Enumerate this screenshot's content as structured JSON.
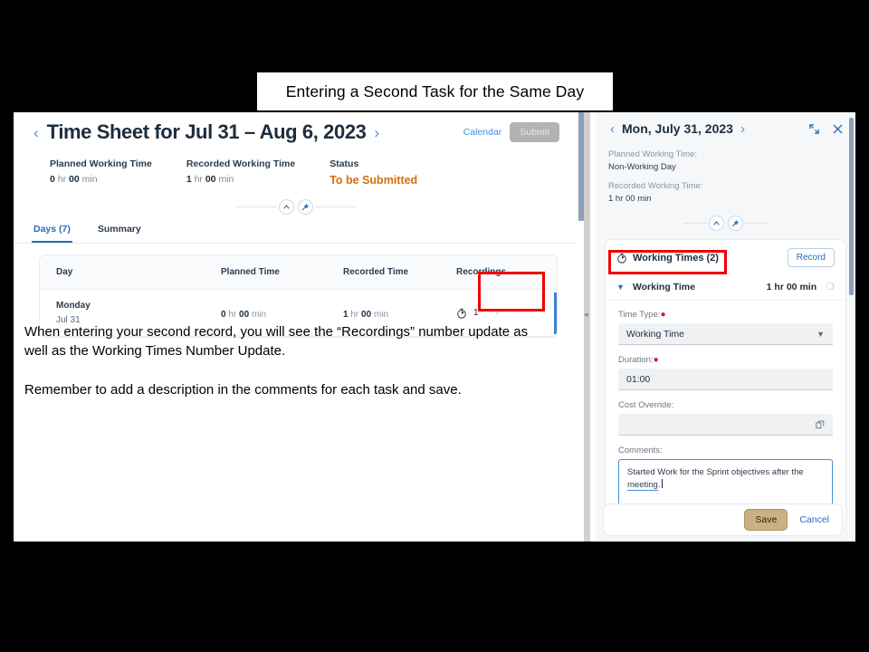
{
  "slide": {
    "caption": "Entering a Second Task for the Same Day",
    "body_paragraph_1": "When entering your second record, you will see the “Recordings” number update as well as the Working Times Number Update.",
    "body_paragraph_2": "Remember to add a description in the comments for each task and save."
  },
  "timesheet": {
    "title": "Time Sheet for Jul 31 – Aug 6, 2023",
    "prev_arrow": "‹",
    "next_arrow": "›",
    "calendar_link": "Calendar",
    "submit_label": "Submit",
    "kpis": [
      {
        "label": "Planned Working Time",
        "value_bold": "0",
        "value_unit_hr": "hr",
        "value_bold2": "00",
        "value_unit_min": "min"
      },
      {
        "label": "Recorded Working Time",
        "value_bold": "1",
        "value_unit_hr": "hr",
        "value_bold2": "00",
        "value_unit_min": "min"
      }
    ],
    "status_label": "Status",
    "status_value": "To be Submitted",
    "tabs": [
      {
        "label": "Days (7)",
        "active": true
      },
      {
        "label": "Summary",
        "active": false
      }
    ],
    "table": {
      "columns": [
        "Day",
        "Planned Time",
        "Recorded Time",
        "Recordings"
      ],
      "rows": [
        {
          "day_name": "Monday",
          "day_date": "Jul 31",
          "planned_hr": "0",
          "planned_hr_unit": "hr",
          "planned_min": "00",
          "planned_min_unit": "min",
          "recorded_hr": "1",
          "recorded_hr_unit": "hr",
          "recorded_min": "00",
          "recorded_min_unit": "min",
          "recordings_count": "1",
          "row_arrow": "›"
        }
      ]
    }
  },
  "detail_panel": {
    "title": "Mon, July 31, 2023",
    "prev_arrow": "‹",
    "next_arrow": "›",
    "planned_label": "Planned Working Time:",
    "planned_value": "Non-Working Day",
    "recorded_label": "Recorded Working Time:",
    "recorded_value": "1 hr 00 min",
    "working_times_title": "Working Times (2)",
    "record_button": "Record",
    "entry": {
      "name": "Working Time",
      "duration": "1 hr 00 min"
    },
    "form": {
      "time_type_label": "Time Type:",
      "time_type_value": "Working Time",
      "duration_label": "Duration:",
      "duration_value": "01:00",
      "cost_override_label": "Cost Override:",
      "cost_override_value": "",
      "comments_label": "Comments:",
      "comments_value_part1": "Started Work for the Sprint objectives after the ",
      "comments_value_spellcheck": "meeting",
      "comments_value_part2": "."
    },
    "save_label": "Save",
    "cancel_label": "Cancel"
  },
  "colors": {
    "accent_blue": "#2b6cb8",
    "status_orange": "#d4700a",
    "highlight_red": "#ee0000",
    "save_tan": "#c9b183",
    "required_pink": "#c4137c"
  }
}
